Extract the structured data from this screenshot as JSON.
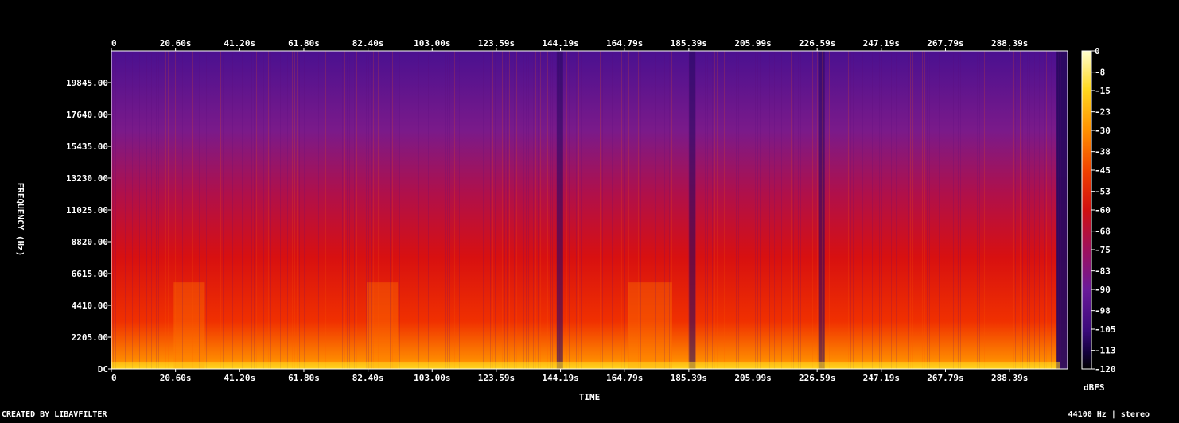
{
  "chart_data": {
    "type": "heatmap",
    "title": "",
    "xlabel": "TIME",
    "ylabel": "FREQUENCY (Hz)",
    "colorbar_label": "dBFS",
    "x_ticks": [
      "0",
      "20.60s",
      "41.20s",
      "61.80s",
      "82.40s",
      "103.00s",
      "123.59s",
      "144.19s",
      "164.79s",
      "185.39s",
      "205.99s",
      "226.59s",
      "247.19s",
      "267.79s",
      "288.39s"
    ],
    "x_tick_values": [
      0,
      20.6,
      41.2,
      61.8,
      82.4,
      103.0,
      123.59,
      144.19,
      164.79,
      185.39,
      205.99,
      226.59,
      247.19,
      267.79,
      288.39
    ],
    "xlim": [
      0,
      307
    ],
    "y_ticks": [
      "DC",
      "2205.00",
      "4410.00",
      "6615.00",
      "8820.00",
      "11025.00",
      "13230.00",
      "15435.00",
      "17640.00",
      "19845.00"
    ],
    "y_tick_values": [
      0,
      2205,
      4410,
      6615,
      8820,
      11025,
      13230,
      15435,
      17640,
      19845
    ],
    "ylim": [
      0,
      22050
    ],
    "colorbar_ticks": [
      "0",
      "-8",
      "-15",
      "-23",
      "-30",
      "-38",
      "-45",
      "-53",
      "-60",
      "-68",
      "-75",
      "-83",
      "-90",
      "-98",
      "-105",
      "-113",
      "-120"
    ],
    "colorbar_tick_values": [
      0,
      -8,
      -15,
      -23,
      -30,
      -38,
      -45,
      -53,
      -60,
      -68,
      -75,
      -83,
      -90,
      -98,
      -105,
      -113,
      -120
    ],
    "zlim": [
      -120,
      0
    ],
    "colormap": [
      "#000000",
      "#12003a",
      "#3a0a7a",
      "#6a1a9a",
      "#a0105a",
      "#d01010",
      "#f04000",
      "#ff9000",
      "#ffd820",
      "#ffffd0"
    ],
    "quiet_times": [
      144,
      186.5,
      228,
      305
    ],
    "tonal_band_times": [
      [
        20,
        30
      ],
      [
        82,
        92
      ],
      [
        166,
        180
      ]
    ]
  },
  "footer": {
    "left": "CREATED BY LIBAVFILTER",
    "right": "44100 Hz | stereo"
  }
}
